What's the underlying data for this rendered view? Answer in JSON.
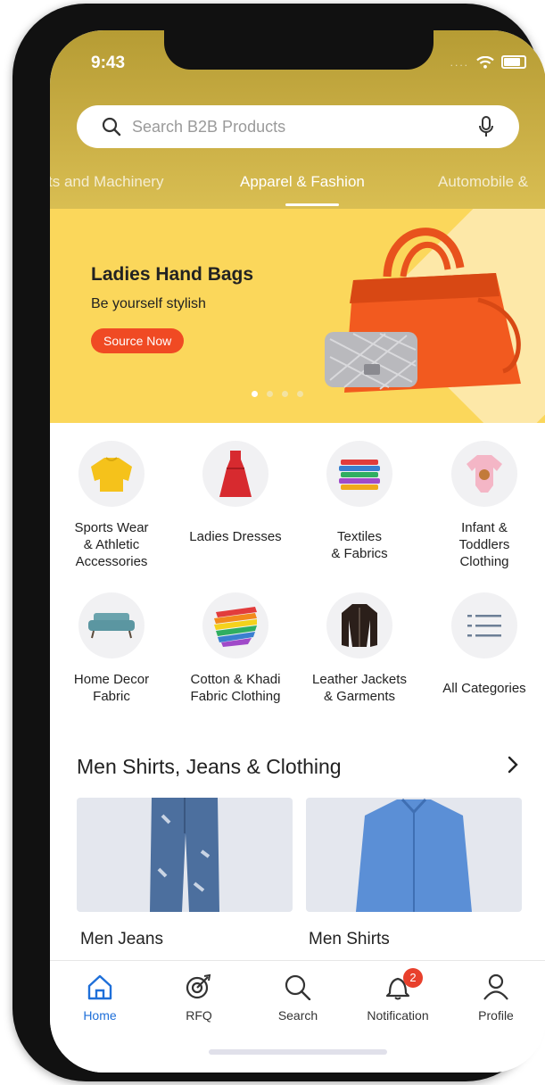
{
  "status_bar": {
    "time": "9:43",
    "signal": "....",
    "wifi_icon": "wifi-icon",
    "battery_icon": "battery-icon"
  },
  "search": {
    "placeholder": "Search B2B Products"
  },
  "category_tabs": [
    {
      "label": "ts and Machinery"
    },
    {
      "label": "Apparel & Fashion"
    },
    {
      "label": "Automobile &"
    }
  ],
  "banner": {
    "title": "Ladies Hand Bags",
    "subtitle": "Be yourself stylish",
    "cta": "Source Now",
    "page_count": 4,
    "active_page": 1
  },
  "categories": [
    {
      "label": "Sports Wear\n& Athletic\nAccessories",
      "icon": "sweater-icon"
    },
    {
      "label": "Ladies Dresses",
      "icon": "dress-icon"
    },
    {
      "label": "Textiles\n& Fabrics",
      "icon": "fabric-stack-icon"
    },
    {
      "label": "Infant &\nToddlers\nClothing",
      "icon": "onesie-icon"
    },
    {
      "label": "Home Decor\nFabric",
      "icon": "sofa-icon"
    },
    {
      "label": "Cotton & Khadi\nFabric Clothing",
      "icon": "colorful-fabric-icon"
    },
    {
      "label": "Leather Jackets\n& Garments",
      "icon": "jacket-icon"
    },
    {
      "label": "All Categories",
      "icon": "list-icon"
    }
  ],
  "section": {
    "title": "Men Shirts, Jeans & Clothing",
    "products": [
      {
        "label": "Men Jeans",
        "icon": "jeans-icon"
      },
      {
        "label": "Men Shirts",
        "icon": "shirt-icon"
      }
    ]
  },
  "tabbar": [
    {
      "label": "Home",
      "icon": "home-icon",
      "active": true
    },
    {
      "label": "RFQ",
      "icon": "rfq-target-icon"
    },
    {
      "label": "Search",
      "icon": "search-icon"
    },
    {
      "label": "Notification",
      "icon": "bell-icon",
      "badge": "2"
    },
    {
      "label": "Profile",
      "icon": "profile-icon"
    }
  ],
  "colors": {
    "accent": "#1e6fd9",
    "header": "#c9ae45",
    "banner": "#fbd75b",
    "cta": "#f04a23",
    "badge": "#e8402c"
  }
}
